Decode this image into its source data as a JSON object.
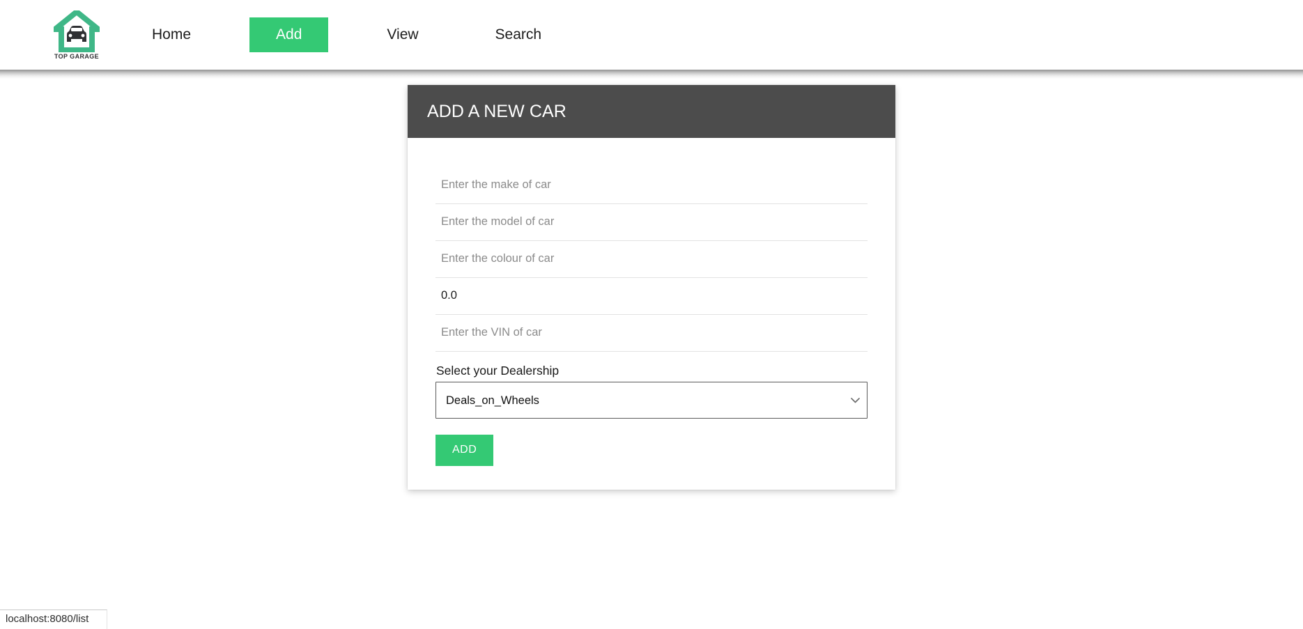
{
  "navbar": {
    "brand": {
      "icon": "garage-car-logo",
      "text": "TOP GARAGE",
      "color": "#3fb787"
    },
    "links": [
      {
        "label": "Home",
        "active": false
      },
      {
        "label": "Add",
        "active": true
      },
      {
        "label": "View",
        "active": false
      },
      {
        "label": "Search",
        "active": false
      }
    ],
    "active_color": "#34c974"
  },
  "card": {
    "title": "ADD A NEW CAR",
    "header_bg": "#4c4c4c",
    "form": {
      "fields": [
        {
          "name": "make",
          "placeholder": "Enter the make of car",
          "value": ""
        },
        {
          "name": "model",
          "placeholder": "Enter the model of car",
          "value": ""
        },
        {
          "name": "colour",
          "placeholder": "Enter the colour of car",
          "value": ""
        },
        {
          "name": "price",
          "placeholder": "",
          "value": "0.0"
        },
        {
          "name": "vin",
          "placeholder": "Enter the VIN of car",
          "value": ""
        }
      ],
      "select": {
        "label": "Select your Dealership",
        "value": "Deals_on_Wheels",
        "options": [
          "Deals_on_Wheels"
        ],
        "chevron_icon": "chevron-down-icon"
      },
      "submit": {
        "label": "ADD",
        "color": "#34c974"
      }
    }
  },
  "status_bar": {
    "text": "localhost:8080/list"
  }
}
